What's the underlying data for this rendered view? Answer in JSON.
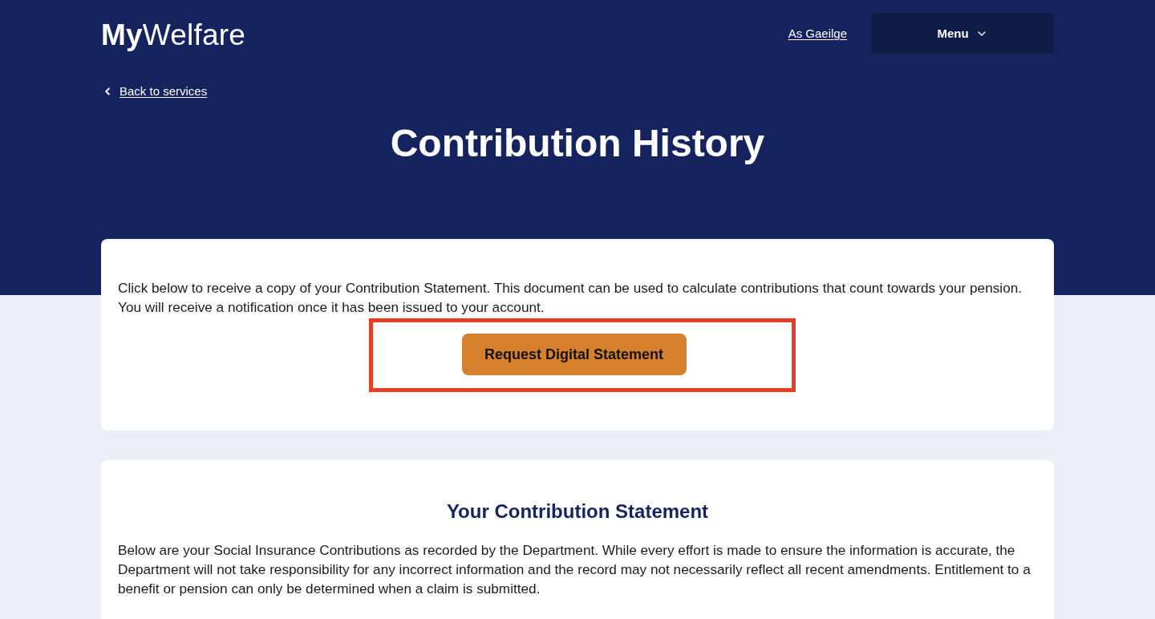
{
  "header": {
    "logo": "**My**Welfare",
    "language_link": "As Gaeilge",
    "menu_button": "Menu"
  },
  "back_link": "Back to services",
  "page_title": "Contribution History",
  "request_card": {
    "text": "Click below to receive a copy of your Contribution Statement. This document can be used to calculate contributions that count towards your pension. You will receive a notification once it has been issued to your account.",
    "button": {
      "label": "Request Digital Statement",
      "highlighted": true
    }
  },
  "statement_card": {
    "title": "Your Contribution Statement",
    "text": "Below are your Social Insurance Contributions as recorded by the Department. While every effort is made to ensure the information is accurate, the Department will not take responsibility for any incorrect information and the record may not necessarily reflect all recent amendments. Entitlement to a benefit or pension can only be determined when a claim is submitted."
  }
}
